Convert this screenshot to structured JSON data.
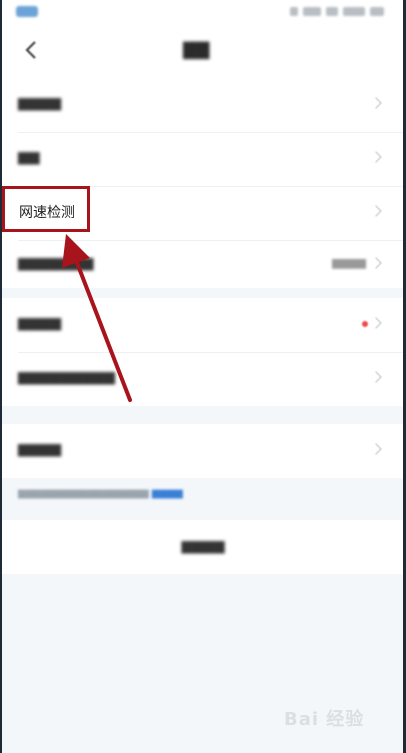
{
  "status_bar": {},
  "header": {},
  "settings": {
    "network_speed_test_label": "网速检测"
  },
  "icons": [
    "back-icon",
    "chevron-right-icon",
    "arrow-annotation-icon",
    "watermark-logo-icon"
  ],
  "colors": {
    "annotation_red": "#a8141b",
    "notification_dot": "#f24b4b",
    "link_blue": "#3a7fd5",
    "background": "#f4f7fa"
  },
  "watermark": {
    "text": "Bai 经验"
  }
}
